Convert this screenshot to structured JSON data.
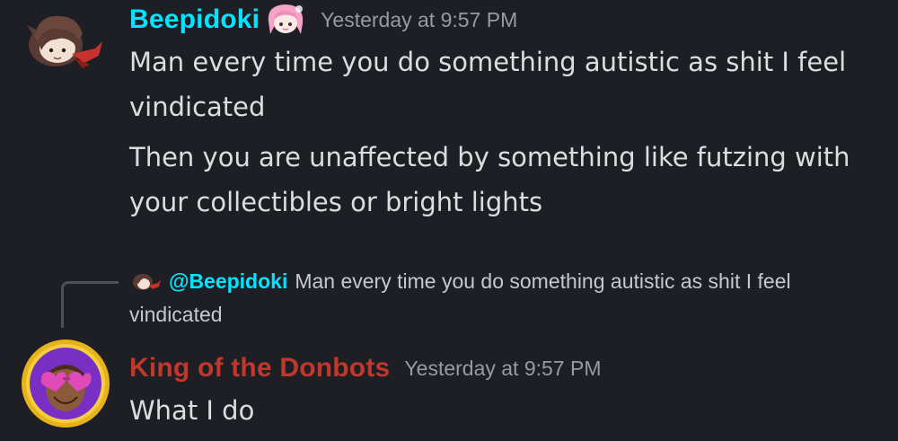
{
  "colors": {
    "background": "#1e1f24",
    "message_text": "#dbdee1",
    "timestamp": "#949ba4",
    "username_beepidoki": "#00e5ff",
    "username_king": "#c0372b",
    "mention": "#00e5ff",
    "reply_line": "#4e5058"
  },
  "messages": [
    {
      "author": "Beepidoki",
      "timestamp": "Yesterday at 9:57 PM",
      "avatar_icon": "anime-girl-avatar-icon",
      "role_icon": "pink-hair-anime-girl-icon",
      "lines": [
        "Man every time you do something autistic as shit I feel vindicated",
        "Then you are unaffected by something like futzing with your collectibles or bright lights"
      ]
    },
    {
      "author": "King of the Donbots",
      "timestamp": "Yesterday at 9:57 PM",
      "avatar_icon": "heart-sunglasses-face-avatar-icon",
      "reply": {
        "mention": "@Beepidoki",
        "text": "Man every time you do something autistic as shit I feel vindicated",
        "avatar_icon": "small-anime-girl-avatar-icon"
      },
      "lines": [
        "What I do"
      ]
    }
  ]
}
